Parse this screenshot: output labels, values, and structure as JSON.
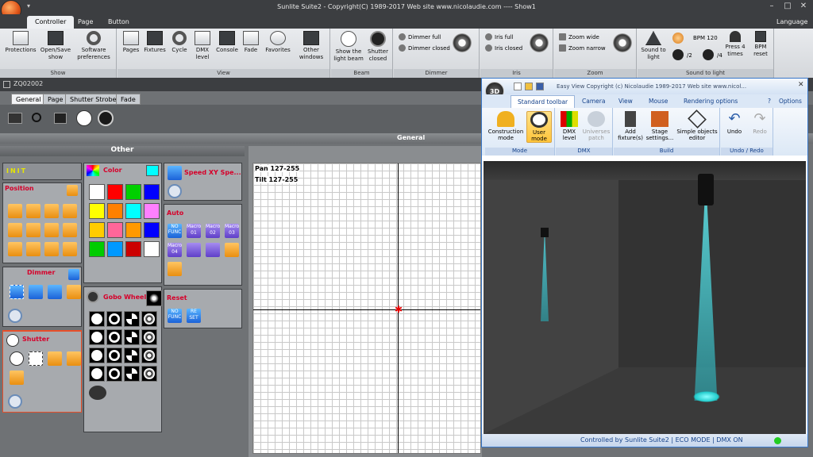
{
  "window": {
    "title": "Sunlite Suite2 - Copyright(C) 1989-2017    Web site www.nicolaudie.com ---- Show1",
    "language": "Language"
  },
  "ribbon_tabs": [
    "Controller",
    "Page",
    "Button"
  ],
  "groups": {
    "show": {
      "label": "Show",
      "buttons": [
        "Protections",
        "Open/Save\nshow",
        "Software\npreferences"
      ]
    },
    "view": {
      "label": "View",
      "buttons": [
        "Pages",
        "Fixtures",
        "Cycle",
        "DMX\nlevel",
        "Console",
        "Fade",
        "Favorites",
        "Other\nwindows"
      ]
    },
    "beam": {
      "label": "Beam",
      "buttons": [
        "Show the\nlight beam",
        "Shutter\nclosed"
      ]
    },
    "dimmer": {
      "label": "Dimmer",
      "items": [
        "Dimmer full",
        "Dimmer closed"
      ]
    },
    "iris": {
      "label": "Iris",
      "items": [
        "Iris full",
        "Iris closed"
      ]
    },
    "zoom": {
      "label": "Zoom",
      "items": [
        "Zoom wide",
        "Zoom narrow"
      ]
    },
    "sound": {
      "label": "Sound to light",
      "sound_btn": "Sound to\nlight",
      "bpm": "BPM 120",
      "div2": "/2",
      "div4": "/4",
      "press4": "Press 4\ntimes",
      "bpm_reset": "BPM\nreset"
    }
  },
  "document": {
    "name": "ZQ02002",
    "tabs": [
      "General",
      "Page",
      "Shutter Strobe",
      "Fade"
    ],
    "header": "General"
  },
  "other": {
    "header": "Other",
    "init": "INIT",
    "panels": {
      "position": "Position",
      "dimmer": "Dimmer",
      "shutter": "Shutter",
      "color": "Color",
      "gobo": "Gobo Wheel",
      "speed": "Speed XY Spe...",
      "auto": "Auto",
      "reset": "Reset"
    },
    "macros": [
      "Macro\n01",
      "Macro\n02",
      "Macro\n03",
      "Macro\n04"
    ],
    "no_func": "NO\nFUNC",
    "reset_label": "RE\nSET"
  },
  "colors": [
    "#ffffff",
    "#ff0000",
    "#00d000",
    "#0000ff",
    "#ffff00",
    "#ff8000",
    "#00ffff",
    "#ff80ff",
    "#ffcc00",
    "#ff6699",
    "#ff9900",
    "#0000ff",
    "#00cc00",
    "#0099ff",
    "#cc0000",
    "#ffffff"
  ],
  "xy": {
    "pan": "Pan 127-255",
    "tilt": "Tilt 127-255"
  },
  "easyview": {
    "title": "Easy View   Copyright (c) Nicolaudie 1989-2017   Web site www.nicol...",
    "logo": "3D",
    "tabs": [
      "Standard toolbar",
      "Camera",
      "View",
      "Mouse",
      "Rendering options"
    ],
    "options": "Options",
    "groups": {
      "mode": {
        "label": "Mode",
        "buttons": [
          "Construction\nmode",
          "User\nmode"
        ]
      },
      "dmx": {
        "label": "DMX",
        "buttons": [
          "DMX\nlevel",
          "Universes\npatch"
        ]
      },
      "build": {
        "label": "Build",
        "buttons": [
          "Add\nfixture(s)",
          "Stage\nsettings...",
          "Simple objects\neditor"
        ]
      },
      "undo": {
        "label": "Undo / Redo",
        "buttons": [
          "Undo",
          "Redo"
        ]
      }
    },
    "status": "Controlled by Sunlite Suite2  |  ECO MODE  |  DMX ON"
  }
}
